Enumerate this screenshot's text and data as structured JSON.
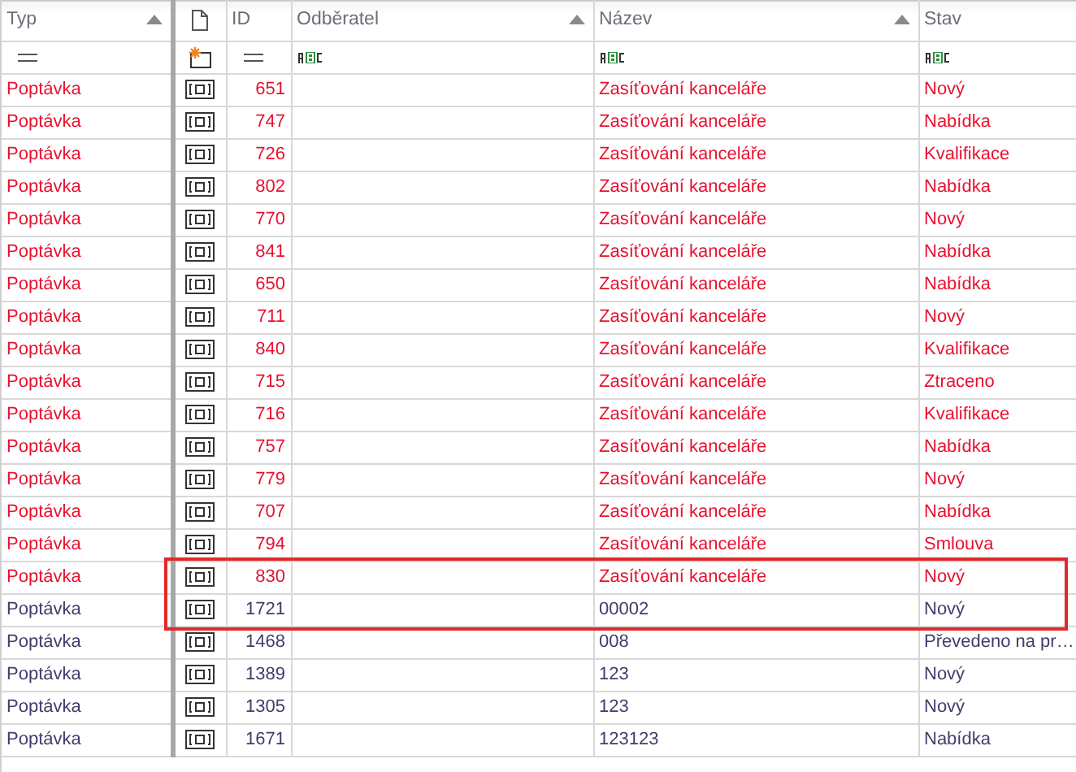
{
  "columns": [
    {
      "label": "Typ",
      "sorted": true,
      "kind": "equals"
    },
    {
      "sorted": false,
      "kind": "new"
    },
    {
      "label": "ID",
      "sorted": false,
      "kind": "equals"
    },
    {
      "label": "Odběratel",
      "sorted": true,
      "kind": "text"
    },
    {
      "label": "Název",
      "sorted": true,
      "kind": "text"
    },
    {
      "label": "Stav",
      "sorted": false,
      "kind": "text"
    }
  ],
  "rows": [
    {
      "typ": "Poptávka",
      "id": "651",
      "nazev": "Zasíťování kanceláře",
      "stav": "Nový",
      "highlighted": true,
      "outlined": false
    },
    {
      "typ": "Poptávka",
      "id": "747",
      "nazev": "Zasíťování kanceláře",
      "stav": "Nabídka",
      "highlighted": true,
      "outlined": false
    },
    {
      "typ": "Poptávka",
      "id": "726",
      "nazev": "Zasíťování kanceláře",
      "stav": "Kvalifikace",
      "highlighted": true,
      "outlined": false
    },
    {
      "typ": "Poptávka",
      "id": "802",
      "nazev": "Zasíťování kanceláře",
      "stav": "Nabídka",
      "highlighted": true,
      "outlined": false
    },
    {
      "typ": "Poptávka",
      "id": "770",
      "nazev": "Zasíťování kanceláře",
      "stav": "Nový",
      "highlighted": true,
      "outlined": false
    },
    {
      "typ": "Poptávka",
      "id": "841",
      "nazev": "Zasíťování kanceláře",
      "stav": "Nabídka",
      "highlighted": true,
      "outlined": false
    },
    {
      "typ": "Poptávka",
      "id": "650",
      "nazev": "Zasíťování kanceláře",
      "stav": "Nabídka",
      "highlighted": true,
      "outlined": false
    },
    {
      "typ": "Poptávka",
      "id": "711",
      "nazev": "Zasíťování kanceláře",
      "stav": "Nový",
      "highlighted": true,
      "outlined": false
    },
    {
      "typ": "Poptávka",
      "id": "840",
      "nazev": "Zasíťování kanceláře",
      "stav": "Kvalifikace",
      "highlighted": true,
      "outlined": false
    },
    {
      "typ": "Poptávka",
      "id": "715",
      "nazev": "Zasíťování kanceláře",
      "stav": "Ztraceno",
      "highlighted": true,
      "outlined": false
    },
    {
      "typ": "Poptávka",
      "id": "716",
      "nazev": "Zasíťování kanceláře",
      "stav": "Kvalifikace",
      "highlighted": true,
      "outlined": false
    },
    {
      "typ": "Poptávka",
      "id": "757",
      "nazev": "Zasíťování kanceláře",
      "stav": "Nabídka",
      "highlighted": true,
      "outlined": false
    },
    {
      "typ": "Poptávka",
      "id": "779",
      "nazev": "Zasíťování kanceláře",
      "stav": "Nový",
      "highlighted": true,
      "outlined": false
    },
    {
      "typ": "Poptávka",
      "id": "707",
      "nazev": "Zasíťování kanceláře",
      "stav": "Nabídka",
      "highlighted": true,
      "outlined": false
    },
    {
      "typ": "Poptávka",
      "id": "794",
      "nazev": "Zasíťování kanceláře",
      "stav": "Smlouva",
      "highlighted": true,
      "outlined": false
    },
    {
      "typ": "Poptávka",
      "id": "830",
      "nazev": "Zasíťování kanceláře",
      "stav": "Nový",
      "highlighted": true,
      "outlined": true
    },
    {
      "typ": "Poptávka",
      "id": "1721",
      "nazev": "00002",
      "stav": "Nový",
      "highlighted": false,
      "outlined": true
    },
    {
      "typ": "Poptávka",
      "id": "1468",
      "nazev": "008",
      "stav": "Převedeno na pr…",
      "highlighted": false,
      "outlined": false
    },
    {
      "typ": "Poptávka",
      "id": "1389",
      "nazev": "123",
      "stav": "Nový",
      "highlighted": false,
      "outlined": false
    },
    {
      "typ": "Poptávka",
      "id": "1305",
      "nazev": "123",
      "stav": "Nový",
      "highlighted": false,
      "outlined": false
    },
    {
      "typ": "Poptávka",
      "id": "1671",
      "nazev": "123123",
      "stav": "Nabídka",
      "highlighted": false,
      "outlined": false
    }
  ]
}
